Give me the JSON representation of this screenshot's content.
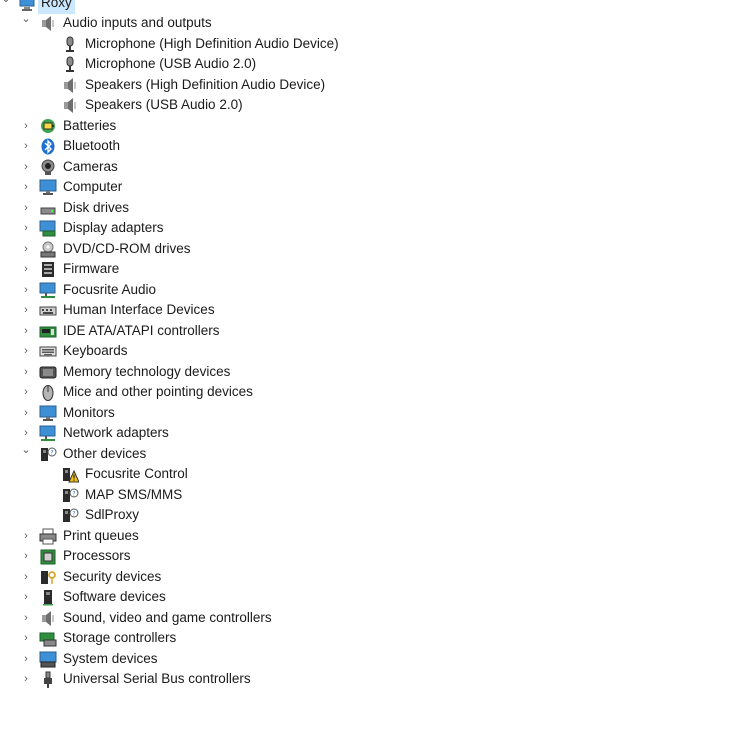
{
  "root": {
    "label": "Roxy",
    "icon": "computer-icon",
    "expanded": true
  },
  "categories": [
    {
      "label": "Audio inputs and outputs",
      "icon": "speaker-icon",
      "expanded": true,
      "children": [
        {
          "label": "Microphone (High Definition Audio Device)",
          "icon": "microphone-icon"
        },
        {
          "label": "Microphone (USB Audio 2.0)",
          "icon": "microphone-icon"
        },
        {
          "label": "Speakers (High Definition Audio Device)",
          "icon": "speaker-icon"
        },
        {
          "label": "Speakers (USB Audio 2.0)",
          "icon": "speaker-icon"
        }
      ]
    },
    {
      "label": "Batteries",
      "icon": "battery-icon"
    },
    {
      "label": "Bluetooth",
      "icon": "bluetooth-icon"
    },
    {
      "label": "Cameras",
      "icon": "camera-icon"
    },
    {
      "label": "Computer",
      "icon": "monitor-icon"
    },
    {
      "label": "Disk drives",
      "icon": "disk-drive-icon"
    },
    {
      "label": "Display adapters",
      "icon": "display-adapter-icon"
    },
    {
      "label": "DVD/CD-ROM drives",
      "icon": "dvd-drive-icon"
    },
    {
      "label": "Firmware",
      "icon": "firmware-icon"
    },
    {
      "label": "Focusrite Audio",
      "icon": "network-monitor-icon"
    },
    {
      "label": "Human Interface Devices",
      "icon": "hid-icon"
    },
    {
      "label": "IDE ATA/ATAPI controllers",
      "icon": "ide-controller-icon"
    },
    {
      "label": "Keyboards",
      "icon": "keyboard-icon"
    },
    {
      "label": "Memory technology devices",
      "icon": "memory-device-icon"
    },
    {
      "label": "Mice and other pointing devices",
      "icon": "mouse-icon"
    },
    {
      "label": "Monitors",
      "icon": "monitor-icon"
    },
    {
      "label": "Network adapters",
      "icon": "network-monitor-icon"
    },
    {
      "label": "Other devices",
      "icon": "unknown-device-icon",
      "expanded": true,
      "children": [
        {
          "label": "Focusrite Control",
          "icon": "warning-device-icon"
        },
        {
          "label": "MAP SMS/MMS",
          "icon": "unknown-device-icon"
        },
        {
          "label": "SdlProxy",
          "icon": "unknown-device-icon"
        }
      ]
    },
    {
      "label": "Print queues",
      "icon": "printer-icon"
    },
    {
      "label": "Processors",
      "icon": "processor-icon"
    },
    {
      "label": "Security devices",
      "icon": "security-device-icon"
    },
    {
      "label": "Software devices",
      "icon": "software-device-icon"
    },
    {
      "label": "Sound, video and game controllers",
      "icon": "speaker-icon"
    },
    {
      "label": "Storage controllers",
      "icon": "storage-controller-icon"
    },
    {
      "label": "System devices",
      "icon": "system-device-icon"
    },
    {
      "label": "Universal Serial Bus controllers",
      "icon": "usb-icon"
    }
  ],
  "glyphs": {
    "expanded": "⌄",
    "collapsed": "›"
  },
  "colors": {
    "selection": "#cce8ff",
    "chevron": "#5a5a5a",
    "text": "#1a1a1a"
  }
}
